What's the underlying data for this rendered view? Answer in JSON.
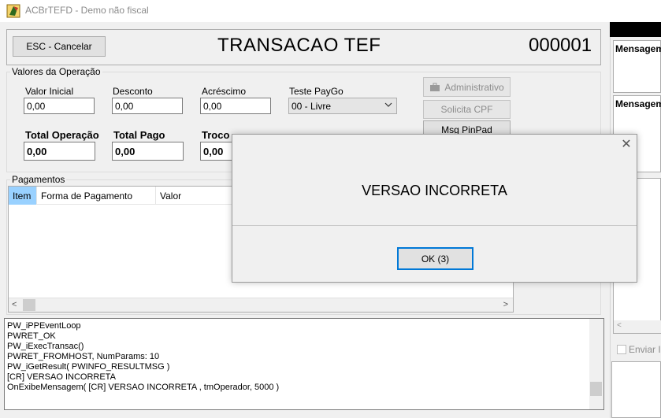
{
  "window": {
    "title": "ACBrTEFD - Demo não fiscal"
  },
  "header": {
    "cancel_button": "ESC - Cancelar",
    "title": "TRANSACAO TEF",
    "number": "000001"
  },
  "valores": {
    "group_title": "Valores da Operação",
    "valor_inicial": {
      "label": "Valor Inicial",
      "value": "0,00"
    },
    "desconto": {
      "label": "Desconto",
      "value": "0,00"
    },
    "acrescimo": {
      "label": "Acréscimo",
      "value": "0,00"
    },
    "teste_paygo": {
      "label": "Teste PayGo",
      "value": "00 - Livre"
    },
    "total_operacao": {
      "label": "Total Operação",
      "value": "0,00"
    },
    "total_pago": {
      "label": "Total Pago",
      "value": "0,00"
    },
    "troco": {
      "label": "Troco",
      "value": "0,00"
    }
  },
  "side_buttons": {
    "administrativo": "Administrativo",
    "solicita_cpf": "Solicita CPF",
    "msg_pinpad": "Msg PinPad"
  },
  "pagamentos": {
    "group_title": "Pagamentos",
    "columns": [
      "Item",
      "Forma de Pagamento",
      "Valor"
    ]
  },
  "log": [
    "PW_iPPEventLoop",
    " PWRET_OK",
    "PW_iExecTransac()",
    " PWRET_FROMHOST, NumParams: 10",
    "PW_iGetResult( PWINFO_RESULTMSG )",
    " [CR]  VERSAO INCORRETA",
    " OnExibeMensagem( [CR]  VERSAO INCORRETA  , tmOperador, 5000 )"
  ],
  "right_panel": {
    "label1": "Mensagem",
    "label2": "Mensagem",
    "checkbox_label": "Enviar In"
  },
  "dialog": {
    "message": "VERSAO INCORRETA",
    "ok_button": "OK (3)"
  }
}
